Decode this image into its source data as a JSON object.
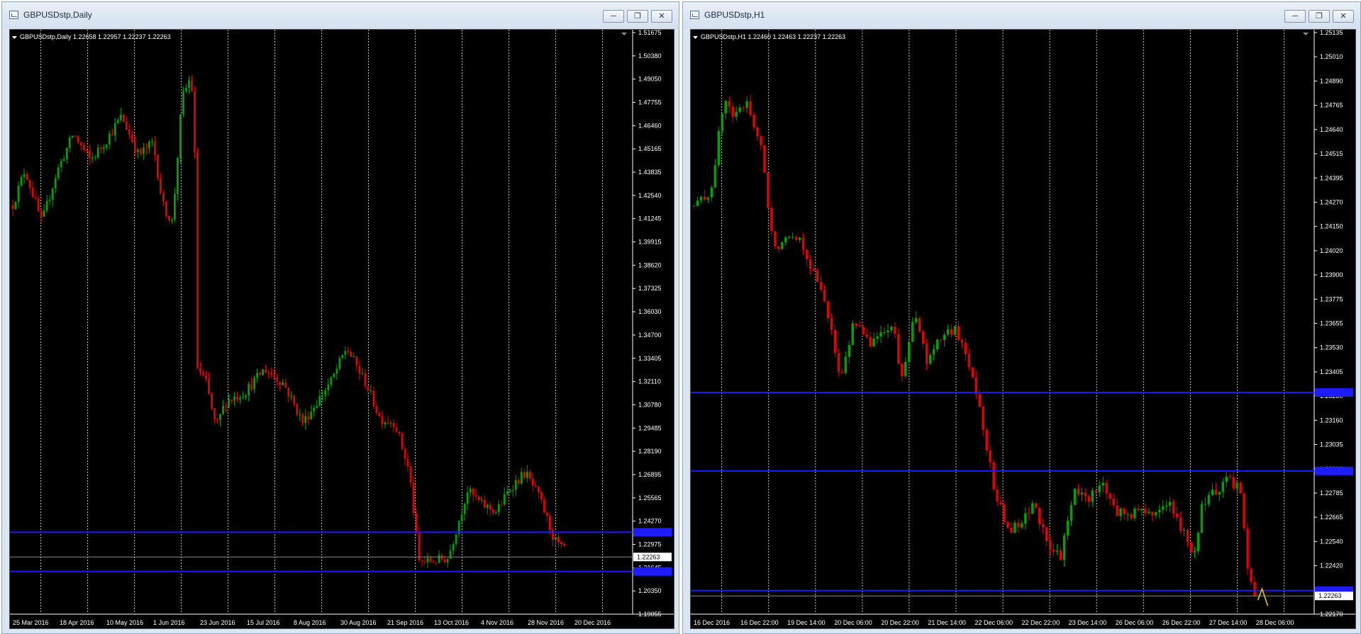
{
  "windows": [
    {
      "id": "left",
      "title": "GBPUSDstp,Daily",
      "chart_data": {
        "type": "candlestick",
        "legend": "GBPUSDstp,Daily  1.22658 1.22957 1.22237 1.22263",
        "ylim": [
          1.19055,
          1.51675
        ],
        "y_ticks": [
          "1.51675",
          "1.50380",
          "1.49050",
          "1.47755",
          "1.46460",
          "1.45165",
          "1.43835",
          "1.42540",
          "1.41245",
          "1.39915",
          "1.38620",
          "1.37325",
          "1.36030",
          "1.34700",
          "1.33405",
          "1.32110",
          "1.30780",
          "1.29485",
          "1.28190",
          "1.26895",
          "1.25565",
          "1.24270",
          "1.22975",
          "1.21645",
          "1.20350",
          "1.19055"
        ],
        "x_ticks": [
          "25 Mar 2016",
          "18 Apr 2016",
          "10 May 2016",
          "1 Jun 2016",
          "23 Jun 2016",
          "15 Jul 2016",
          "8 Aug 2016",
          "30 Aug 2016",
          "21 Sep 2016",
          "13 Oct 2016",
          "4 Nov 2016",
          "28 Nov 2016",
          "20 Dec 2016"
        ],
        "current_price": "1.22263",
        "horizontal_lines": [
          1.2365,
          1.2145
        ],
        "bar_count": 195,
        "waypoints": [
          [
            0,
            1.42
          ],
          [
            5,
            1.44
          ],
          [
            12,
            1.41
          ],
          [
            18,
            1.438
          ],
          [
            25,
            1.46
          ],
          [
            32,
            1.445
          ],
          [
            38,
            1.455
          ],
          [
            45,
            1.47
          ],
          [
            52,
            1.448
          ],
          [
            58,
            1.455
          ],
          [
            62,
            1.42
          ],
          [
            66,
            1.41
          ],
          [
            70,
            1.48
          ],
          [
            73,
            1.49
          ],
          [
            75,
            1.48
          ],
          [
            76,
            1.33
          ],
          [
            80,
            1.32
          ],
          [
            84,
            1.295
          ],
          [
            88,
            1.31
          ],
          [
            96,
            1.315
          ],
          [
            104,
            1.328
          ],
          [
            112,
            1.32
          ],
          [
            120,
            1.298
          ],
          [
            126,
            1.31
          ],
          [
            132,
            1.322
          ],
          [
            138,
            1.34
          ],
          [
            146,
            1.32
          ],
          [
            152,
            1.3
          ],
          [
            158,
            1.298
          ],
          [
            164,
            1.27
          ],
          [
            168,
            1.22
          ],
          [
            172,
            1.22
          ],
          [
            180,
            1.222
          ],
          [
            188,
            1.26
          ],
          [
            194,
            1.252
          ],
          [
            200,
            1.248
          ],
          [
            206,
            1.262
          ],
          [
            212,
            1.27
          ],
          [
            218,
            1.255
          ],
          [
            224,
            1.232
          ],
          [
            228,
            1.226
          ]
        ]
      }
    },
    {
      "id": "right",
      "title": "GBPUSDstp,H1",
      "chart_data": {
        "type": "candlestick",
        "legend": "GBPUSDstp,H1  1.22460 1.22463 1.22237 1.22263",
        "ylim": [
          1.2217,
          1.25135
        ],
        "y_ticks": [
          "1.25135",
          "1.25010",
          "1.24890",
          "1.24765",
          "1.24640",
          "1.24515",
          "1.24395",
          "1.24270",
          "1.24150",
          "1.24020",
          "1.23900",
          "1.23775",
          "1.23655",
          "1.23530",
          "1.23405",
          "1.23280",
          "1.23160",
          "1.23035",
          "1.22910",
          "1.22785",
          "1.22665",
          "1.22540",
          "1.22420",
          "1.22295",
          "1.22170"
        ],
        "x_ticks": [
          "16 Dec 2016",
          "16 Dec 22:00",
          "19 Dec 14:00",
          "20 Dec 06:00",
          "20 Dec 22:00",
          "21 Dec 14:00",
          "22 Dec 06:00",
          "22 Dec 22:00",
          "23 Dec 14:00",
          "26 Dec 06:00",
          "26 Dec 22:00",
          "27 Dec 14:00",
          "28 Dec 06:00"
        ],
        "current_price": "1.22263",
        "horizontal_lines": [
          1.233,
          1.229,
          1.2229
        ],
        "bar_count": 160,
        "waypoints": [
          [
            0,
            1.2425
          ],
          [
            5,
            1.2432
          ],
          [
            9,
            1.248
          ],
          [
            12,
            1.247
          ],
          [
            16,
            1.2478
          ],
          [
            20,
            1.2455
          ],
          [
            24,
            1.2402
          ],
          [
            28,
            1.2412
          ],
          [
            32,
            1.2408
          ],
          [
            36,
            1.239
          ],
          [
            40,
            1.2372
          ],
          [
            44,
            1.2335
          ],
          [
            48,
            1.2368
          ],
          [
            52,
            1.2355
          ],
          [
            56,
            1.236
          ],
          [
            60,
            1.2362
          ],
          [
            62,
            1.2335
          ],
          [
            66,
            1.237
          ],
          [
            70,
            1.2345
          ],
          [
            74,
            1.2358
          ],
          [
            78,
            1.2362
          ],
          [
            82,
            1.2348
          ],
          [
            86,
            1.232
          ],
          [
            90,
            1.228
          ],
          [
            94,
            1.226
          ],
          [
            98,
            1.2262
          ],
          [
            102,
            1.2275
          ],
          [
            106,
            1.225
          ],
          [
            110,
            1.2247
          ],
          [
            114,
            1.228
          ],
          [
            118,
            1.2275
          ],
          [
            122,
            1.2285
          ],
          [
            126,
            1.227
          ],
          [
            130,
            1.2268
          ],
          [
            134,
            1.227
          ],
          [
            138,
            1.2268
          ],
          [
            142,
            1.2275
          ],
          [
            146,
            1.226
          ],
          [
            150,
            1.2248
          ],
          [
            152,
            1.227
          ],
          [
            156,
            1.228
          ],
          [
            160,
            1.2285
          ],
          [
            164,
            1.228
          ],
          [
            166,
            1.224
          ],
          [
            168,
            1.2226
          ]
        ]
      }
    }
  ],
  "colors": {
    "bull": "#00a000",
    "bear": "#e00000",
    "grid": "#c8c8c8",
    "support_line": "#1c1cff",
    "price_line": "#8a8a8a",
    "axis_text": "#ffffff",
    "chart_bg": "#000000"
  },
  "icons": [
    "chart-window-icon",
    "minimize-icon",
    "restore-icon",
    "close-icon",
    "chart-dropdown-icon"
  ]
}
